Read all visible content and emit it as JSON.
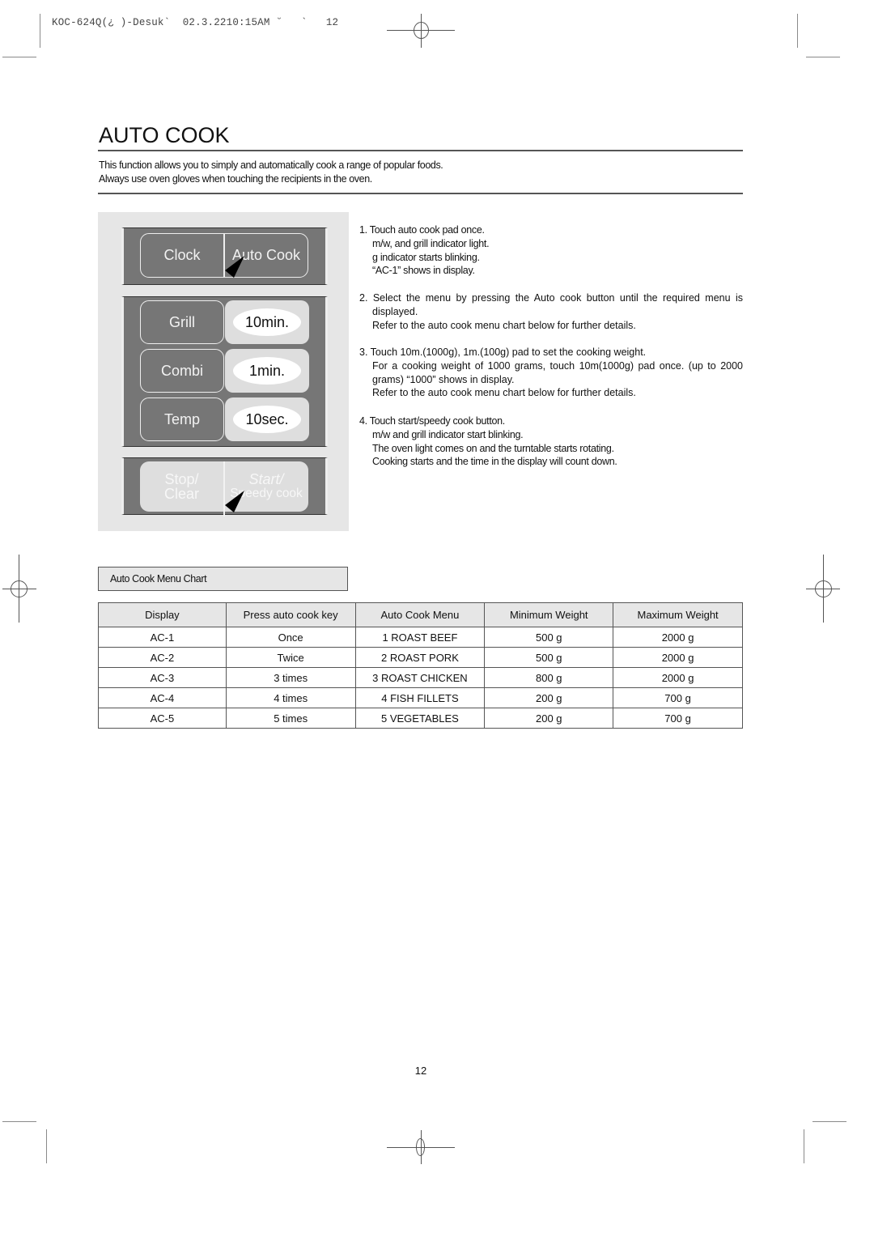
{
  "print_header": {
    "slug": "KOC-624Q(¿ )-Desuk`  02.3.2210:15AM ˘   `   12"
  },
  "page": {
    "title": "AUTO COOK",
    "intro": [
      "This function allows you to simply and automatically cook a range of popular foods.",
      "Always use oven gloves when touching the recipients in the oven."
    ],
    "page_number": "12"
  },
  "control_panel": {
    "top_row": {
      "left": "Clock",
      "right": "Auto Cook"
    },
    "rows": [
      {
        "left": "Grill",
        "right": "10min."
      },
      {
        "left": "Combi",
        "right": "1min."
      },
      {
        "left": "Temp",
        "right": "10sec."
      }
    ],
    "bottom_row": {
      "left_line1": "Stop/",
      "left_line2": "Clear",
      "right_line1": "Start/",
      "right_line2": "Speedy cook"
    },
    "pointer_icons": [
      "pointer-arrow-icon",
      "pointer-arrow-icon"
    ]
  },
  "steps": [
    {
      "lines": [
        "1. Touch auto cook   pad once.",
        "m/w, and grill  indicator light.",
        "g indicator starts blinking.",
        "“AC-1” shows in display."
      ]
    },
    {
      "lines": [
        "2. Select the menu by pressing the Auto cook button until the required menu is displayed.",
        "Refer to the auto cook menu chart below for further details."
      ]
    },
    {
      "lines": [
        "3. Touch 10m.(1000g), 1m.(100g) pad to set the cooking weight.",
        "For a cooking weight of 1000 grams, touch 10m(1000g) pad once. (up to 2000 grams) “1000” shows in display.",
        "Refer to the auto cook menu chart below for further details."
      ]
    },
    {
      "lines": [
        "4. Touch start/speedy cook    button.",
        "m/w and grill  indicator start blinking.",
        "The oven light comes on and the turntable starts rotating.",
        "Cooking starts and the time in the display will count down."
      ]
    }
  ],
  "menu_chart": {
    "caption": "Auto Cook Menu Chart",
    "headers": [
      "Display",
      "Press auto cook key",
      "Auto Cook Menu",
      "Minimum Weight",
      "Maximum Weight"
    ],
    "rows": [
      [
        "AC-1",
        "Once",
        "1 ROAST BEEF",
        "500 g",
        "2000 g"
      ],
      [
        "AC-2",
        "Twice",
        "2 ROAST PORK",
        "500 g",
        "2000 g"
      ],
      [
        "AC-3",
        "3 times",
        "3 ROAST CHICKEN",
        "800 g",
        "2000 g"
      ],
      [
        "AC-4",
        "4 times",
        "4 FISH FILLETS",
        "200 g",
        "700 g"
      ],
      [
        "AC-5",
        "5 times",
        "5 VEGETABLES",
        "200 g",
        "700 g"
      ]
    ]
  }
}
